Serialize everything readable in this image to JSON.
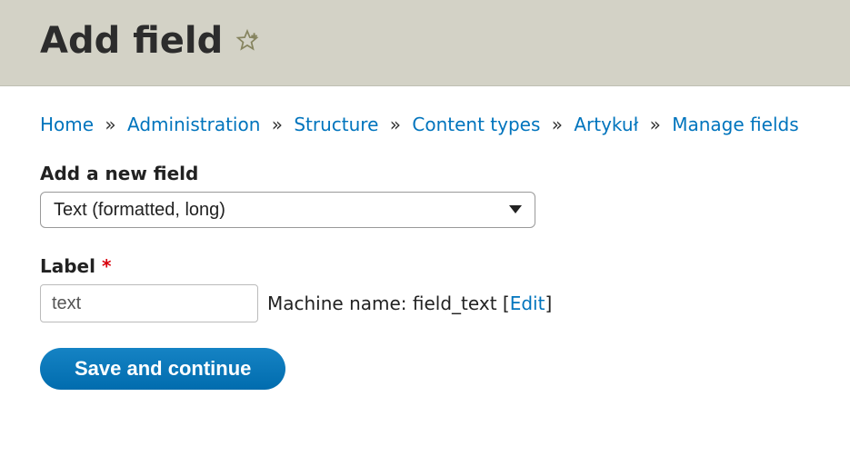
{
  "header": {
    "title": "Add field"
  },
  "breadcrumb": {
    "items": [
      {
        "label": "Home"
      },
      {
        "label": "Administration"
      },
      {
        "label": "Structure"
      },
      {
        "label": "Content types"
      },
      {
        "label": "Artykuł"
      },
      {
        "label": "Manage fields"
      }
    ],
    "separator": "»"
  },
  "form": {
    "field_type_label": "Add a new field",
    "field_type_value": "Text (formatted, long)",
    "label_label": "Label",
    "label_value": "text",
    "machine_prefix": "Machine name: ",
    "machine_name": "field_text",
    "edit_link": "Edit",
    "submit": "Save and continue"
  }
}
